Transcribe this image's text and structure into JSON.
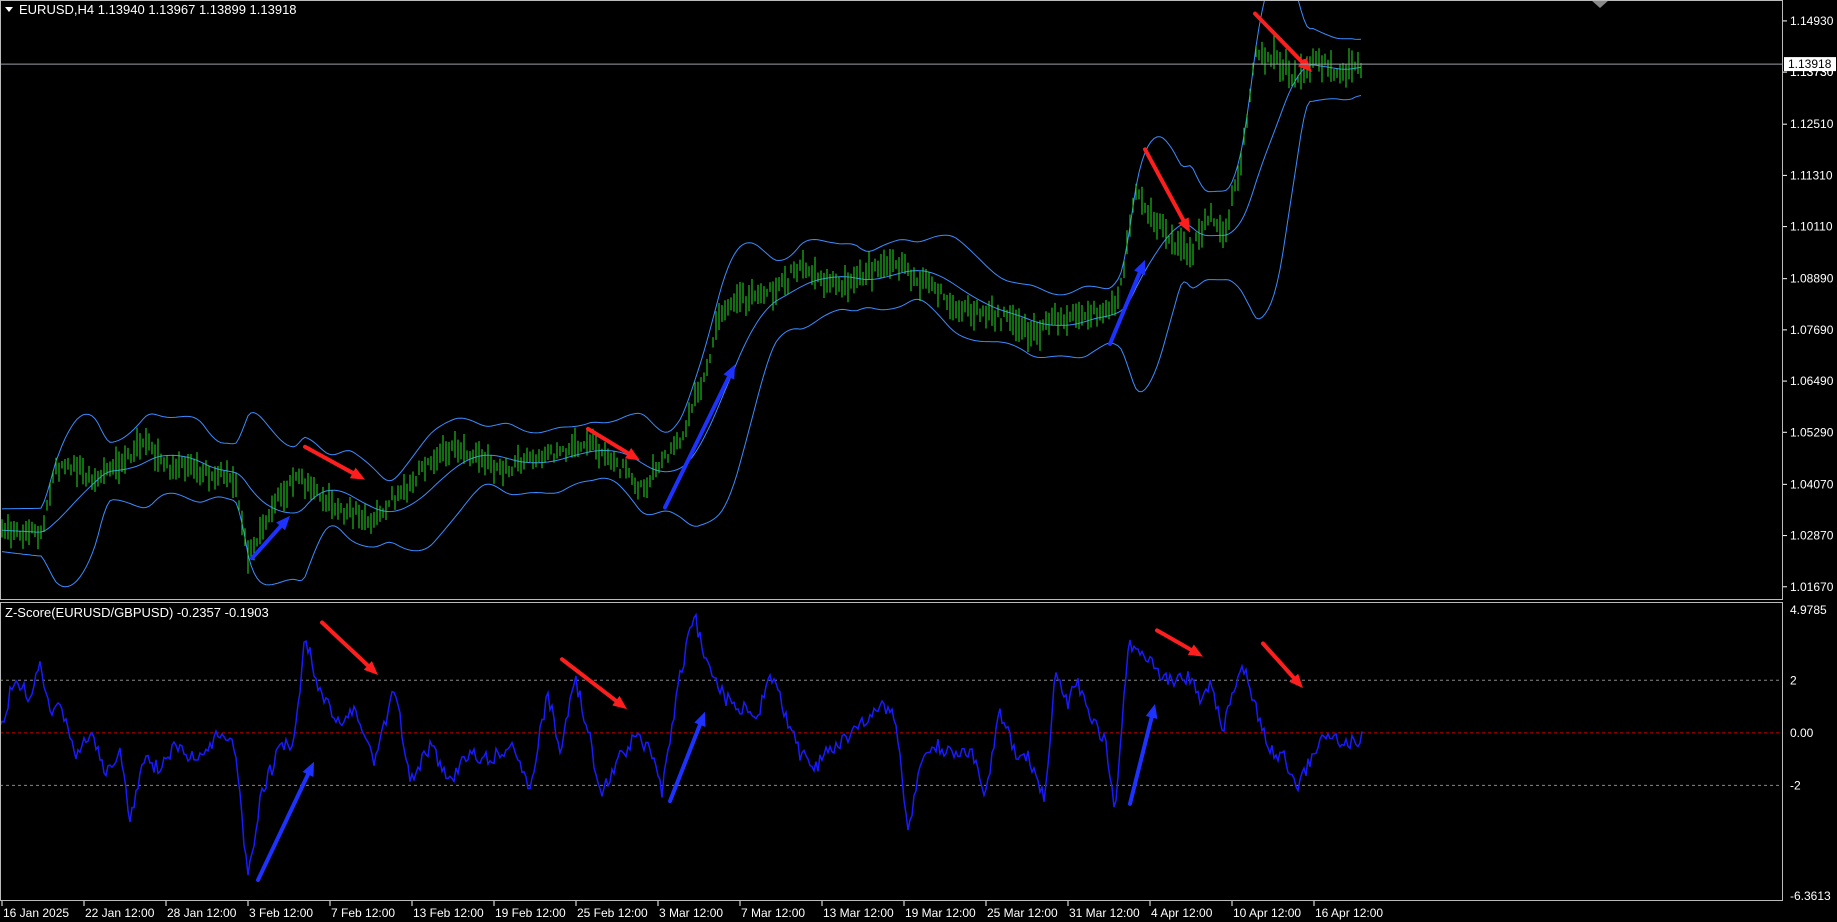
{
  "price_panel": {
    "title": "EURUSD,H4  1.13940 1.13967 1.13899 1.13918",
    "current_price_label": "1.13918",
    "overlapped_tick": "1.13730"
  },
  "indicator_panel": {
    "title": "Z-Score(EURUSD/GBPUSD) -0.2357 -0.1903"
  },
  "colors": {
    "background": "#000000",
    "candles": "#22dd22",
    "bands": "#3a8cff",
    "zscore_line": "#1a1aff",
    "zero_line": "#cc0000",
    "level_lines": "#888888",
    "arrow_up": "#1e32ff",
    "arrow_down": "#ff1e1e",
    "axis": "#ffffff"
  },
  "chart_data": [
    {
      "type": "candlestick",
      "title": "EURUSD,H4",
      "ylim": [
        1.0136,
        1.1542
      ],
      "y_ticks": [
        "1.14930",
        "1.13730",
        "1.12510",
        "1.11310",
        "1.10110",
        "1.08890",
        "1.07690",
        "1.06490",
        "1.05290",
        "1.04070",
        "1.02870",
        "1.01670"
      ],
      "x_ticks": [
        "16 Jan 2025",
        "22 Jan 12:00",
        "28 Jan 12:00",
        "3 Feb 12:00",
        "7 Feb 12:00",
        "13 Feb 12:00",
        "19 Feb 12:00",
        "25 Feb 12:00",
        "3 Mar 12:00",
        "7 Mar 12:00",
        "13 Mar 12:00",
        "19 Mar 12:00",
        "25 Mar 12:00",
        "31 Mar 12:00",
        "4 Apr 12:00",
        "10 Apr 12:00",
        "16 Apr 12:00"
      ],
      "current_price": 1.13918,
      "indicator": "Bollinger Bands",
      "close_anchors": [
        [
          0,
          1.03
        ],
        [
          40,
          1.029
        ],
        [
          55,
          1.044
        ],
        [
          75,
          1.045
        ],
        [
          95,
          1.042
        ],
        [
          120,
          1.046
        ],
        [
          145,
          1.051
        ],
        [
          165,
          1.045
        ],
        [
          200,
          1.044
        ],
        [
          235,
          1.042
        ],
        [
          248,
          1.024
        ],
        [
          270,
          1.035
        ],
        [
          295,
          1.042
        ],
        [
          320,
          1.039
        ],
        [
          345,
          1.034
        ],
        [
          375,
          1.033
        ],
        [
          400,
          1.039
        ],
        [
          430,
          1.046
        ],
        [
          455,
          1.049
        ],
        [
          480,
          1.047
        ],
        [
          505,
          1.044
        ],
        [
          530,
          1.047
        ],
        [
          560,
          1.048
        ],
        [
          590,
          1.05
        ],
        [
          615,
          1.046
        ],
        [
          640,
          1.04
        ],
        [
          660,
          1.045
        ],
        [
          680,
          1.051
        ],
        [
          700,
          1.064
        ],
        [
          720,
          1.079
        ],
        [
          740,
          1.084
        ],
        [
          760,
          1.085
        ],
        [
          780,
          1.087
        ],
        [
          800,
          1.092
        ],
        [
          825,
          1.088
        ],
        [
          850,
          1.088
        ],
        [
          875,
          1.091
        ],
        [
          900,
          1.092
        ],
        [
          925,
          1.088
        ],
        [
          950,
          1.083
        ],
        [
          980,
          1.081
        ],
        [
          1010,
          1.079
        ],
        [
          1030,
          1.076
        ],
        [
          1055,
          1.079
        ],
        [
          1080,
          1.081
        ],
        [
          1105,
          1.08
        ],
        [
          1120,
          1.086
        ],
        [
          1135,
          1.11
        ],
        [
          1150,
          1.104
        ],
        [
          1170,
          1.098
        ],
        [
          1190,
          1.095
        ],
        [
          1210,
          1.104
        ],
        [
          1225,
          1.1
        ],
        [
          1240,
          1.115
        ],
        [
          1255,
          1.142
        ],
        [
          1275,
          1.14
        ],
        [
          1295,
          1.136
        ],
        [
          1315,
          1.14
        ],
        [
          1340,
          1.137
        ],
        [
          1362,
          1.1392
        ]
      ],
      "zscore_anchors": [
        [
          0,
          0.1
        ],
        [
          15,
          2.2
        ],
        [
          30,
          1.2
        ],
        [
          40,
          2.5
        ],
        [
          50,
          0.8
        ],
        [
          60,
          1.3
        ],
        [
          75,
          -1.0
        ],
        [
          90,
          0.1
        ],
        [
          105,
          -1.4
        ],
        [
          120,
          -0.7
        ],
        [
          130,
          -3.4
        ],
        [
          145,
          -0.8
        ],
        [
          160,
          -1.5
        ],
        [
          175,
          -0.4
        ],
        [
          195,
          -1.0
        ],
        [
          215,
          -0.2
        ],
        [
          235,
          -0.4
        ],
        [
          248,
          -5.6
        ],
        [
          262,
          -2.2
        ],
        [
          278,
          -0.8
        ],
        [
          295,
          -0.2
        ],
        [
          305,
          3.8
        ],
        [
          320,
          1.5
        ],
        [
          340,
          0.4
        ],
        [
          355,
          1.0
        ],
        [
          375,
          -1.2
        ],
        [
          395,
          1.8
        ],
        [
          410,
          -2.0
        ],
        [
          430,
          -0.5
        ],
        [
          450,
          -1.8
        ],
        [
          470,
          -0.8
        ],
        [
          490,
          -1.0
        ],
        [
          510,
          -0.5
        ],
        [
          530,
          -2.0
        ],
        [
          548,
          1.5
        ],
        [
          560,
          -0.7
        ],
        [
          575,
          2.1
        ],
        [
          590,
          -0.2
        ],
        [
          600,
          -2.3
        ],
        [
          618,
          -1.0
        ],
        [
          635,
          -0.2
        ],
        [
          650,
          -0.5
        ],
        [
          662,
          -2.3
        ],
        [
          678,
          1.8
        ],
        [
          694,
          4.5
        ],
        [
          708,
          2.4
        ],
        [
          725,
          1.3
        ],
        [
          745,
          0.9
        ],
        [
          760,
          0.8
        ],
        [
          770,
          2.4
        ],
        [
          785,
          0.7
        ],
        [
          800,
          -0.8
        ],
        [
          815,
          -1.4
        ],
        [
          830,
          -0.6
        ],
        [
          848,
          -0.2
        ],
        [
          865,
          0.4
        ],
        [
          880,
          1.2
        ],
        [
          895,
          0.6
        ],
        [
          908,
          -3.7
        ],
        [
          922,
          -1.0
        ],
        [
          938,
          -0.5
        ],
        [
          955,
          -1.0
        ],
        [
          970,
          -0.6
        ],
        [
          985,
          -2.3
        ],
        [
          1000,
          0.8
        ],
        [
          1015,
          -0.8
        ],
        [
          1030,
          -1.0
        ],
        [
          1045,
          -2.6
        ],
        [
          1055,
          2.2
        ],
        [
          1068,
          1.0
        ],
        [
          1075,
          2.1
        ],
        [
          1090,
          0.7
        ],
        [
          1105,
          -0.3
        ],
        [
          1115,
          -2.8
        ],
        [
          1128,
          3.3
        ],
        [
          1140,
          3.2
        ],
        [
          1155,
          2.4
        ],
        [
          1170,
          2.0
        ],
        [
          1185,
          2.2
        ],
        [
          1200,
          1.4
        ],
        [
          1212,
          1.9
        ],
        [
          1222,
          0.0
        ],
        [
          1242,
          2.8
        ],
        [
          1255,
          1.0
        ],
        [
          1270,
          -0.6
        ],
        [
          1285,
          -1.0
        ],
        [
          1295,
          -2.1
        ],
        [
          1310,
          -1.1
        ],
        [
          1325,
          0.0
        ],
        [
          1340,
          -0.4
        ],
        [
          1355,
          -0.3
        ],
        [
          1362,
          -0.2
        ]
      ]
    },
    {
      "type": "line",
      "title": "Z-Score(EURUSD/GBPUSD)",
      "series": [
        {
          "name": "Z-Score(EURUSD/GBPUSD)"
        }
      ],
      "ylim": [
        -6.3613,
        4.9785
      ],
      "y_ticks": [
        "4.9785",
        "2",
        "0.00",
        "-2",
        "-6.3613"
      ],
      "levels": [
        2,
        0,
        -2
      ],
      "current_values": [
        -0.2357,
        -0.1903
      ]
    }
  ],
  "annotations": {
    "price_arrows": [
      {
        "dir": "up",
        "x1": 252,
        "y1": 1.0234,
        "x2": 290,
        "y2": 1.0333
      },
      {
        "dir": "down",
        "x1": 305,
        "y1": 1.0495,
        "x2": 365,
        "y2": 1.0418
      },
      {
        "dir": "down",
        "x1": 588,
        "y1": 1.0537,
        "x2": 640,
        "y2": 1.0463
      },
      {
        "dir": "up",
        "x1": 665,
        "y1": 1.0353,
        "x2": 735,
        "y2": 1.0688
      },
      {
        "dir": "up",
        "x1": 1110,
        "y1": 1.0736,
        "x2": 1145,
        "y2": 1.0933
      },
      {
        "dir": "down",
        "x1": 1145,
        "y1": 1.1192,
        "x2": 1190,
        "y2": 1.0997
      },
      {
        "dir": "down",
        "x1": 1255,
        "y1": 1.151,
        "x2": 1312,
        "y2": 1.1373
      }
    ],
    "indicator_arrows": [
      {
        "dir": "up",
        "x1": 258,
        "y1": -5.6,
        "x2": 314,
        "y2": -1.1
      },
      {
        "dir": "down",
        "x1": 322,
        "y1": 4.2,
        "x2": 378,
        "y2": 2.2
      },
      {
        "dir": "down",
        "x1": 562,
        "y1": 2.8,
        "x2": 627,
        "y2": 0.9
      },
      {
        "dir": "up",
        "x1": 670,
        "y1": -2.6,
        "x2": 705,
        "y2": 0.8
      },
      {
        "dir": "up",
        "x1": 1130,
        "y1": -2.7,
        "x2": 1155,
        "y2": 1.1
      },
      {
        "dir": "down",
        "x1": 1157,
        "y1": 3.9,
        "x2": 1203,
        "y2": 2.9
      },
      {
        "dir": "down",
        "x1": 1263,
        "y1": 3.4,
        "x2": 1303,
        "y2": 1.7
      }
    ]
  }
}
